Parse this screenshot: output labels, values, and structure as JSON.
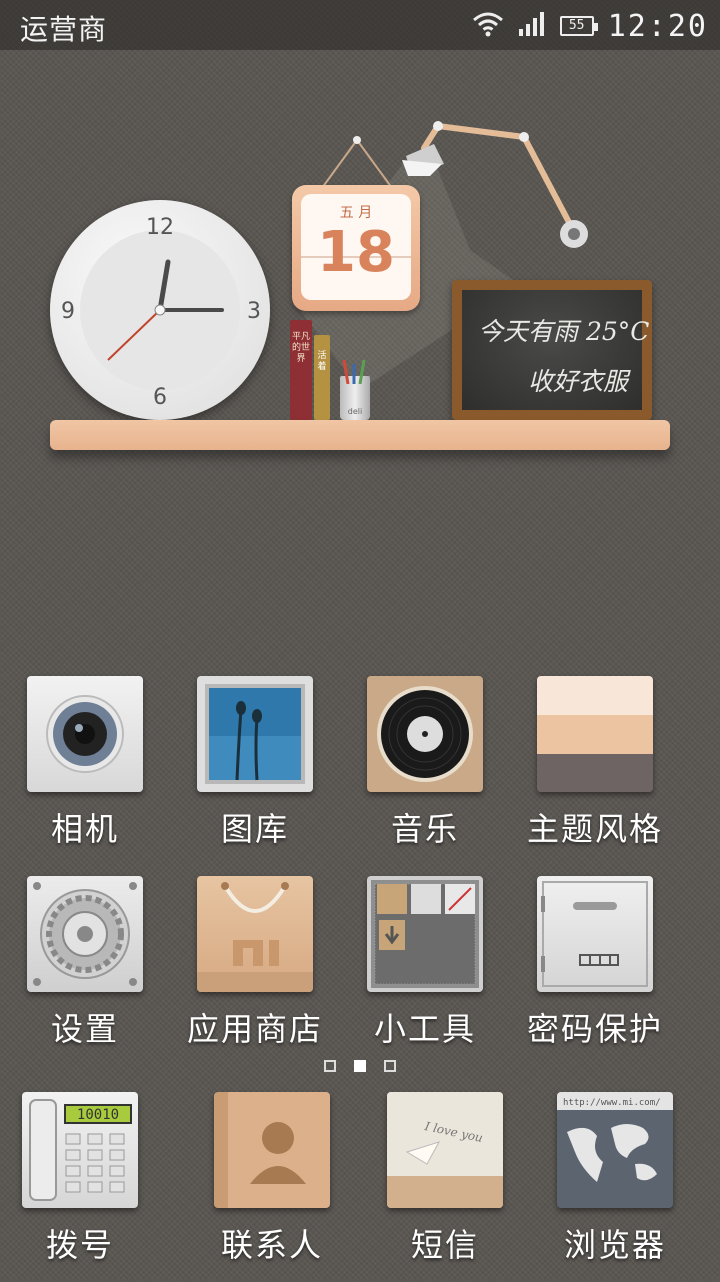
{
  "status_bar": {
    "carrier": "运营商",
    "battery_level": "55",
    "time": "12:20",
    "icons": [
      "wifi-icon",
      "signal-icon",
      "battery-icon"
    ]
  },
  "widget": {
    "clock": {
      "numerals": [
        "12",
        "3",
        "6",
        "9"
      ],
      "time": "12:20"
    },
    "calendar": {
      "month": "五 月",
      "day": "18"
    },
    "books": {
      "book1": "平凡的世界",
      "book2": "活着"
    },
    "pen_cup": "deli",
    "chalkboard": {
      "line1": "今天有雨 25°C",
      "line2": "收好衣服"
    }
  },
  "apps": {
    "row1": [
      {
        "label": "相机",
        "icon": "camera-icon"
      },
      {
        "label": "图库",
        "icon": "gallery-icon"
      },
      {
        "label": "音乐",
        "icon": "music-icon"
      },
      {
        "label": "主题风格",
        "icon": "theme-icon"
      }
    ],
    "row2": [
      {
        "label": "设置",
        "icon": "settings-icon"
      },
      {
        "label": "应用商店",
        "icon": "store-icon"
      },
      {
        "label": "小工具",
        "icon": "widgets-icon"
      },
      {
        "label": "密码保护",
        "icon": "safe-icon"
      }
    ]
  },
  "page_indicator": {
    "count": 3,
    "active": 2
  },
  "dock": {
    "items": [
      {
        "label": "拨号",
        "icon": "phone-icon",
        "display": "10010"
      },
      {
        "label": "联系人",
        "icon": "contacts-icon"
      },
      {
        "label": "短信",
        "icon": "sms-icon",
        "note": "I love you"
      },
      {
        "label": "浏览器",
        "icon": "browser-icon",
        "url": "http://www.mi.com/"
      }
    ]
  }
}
